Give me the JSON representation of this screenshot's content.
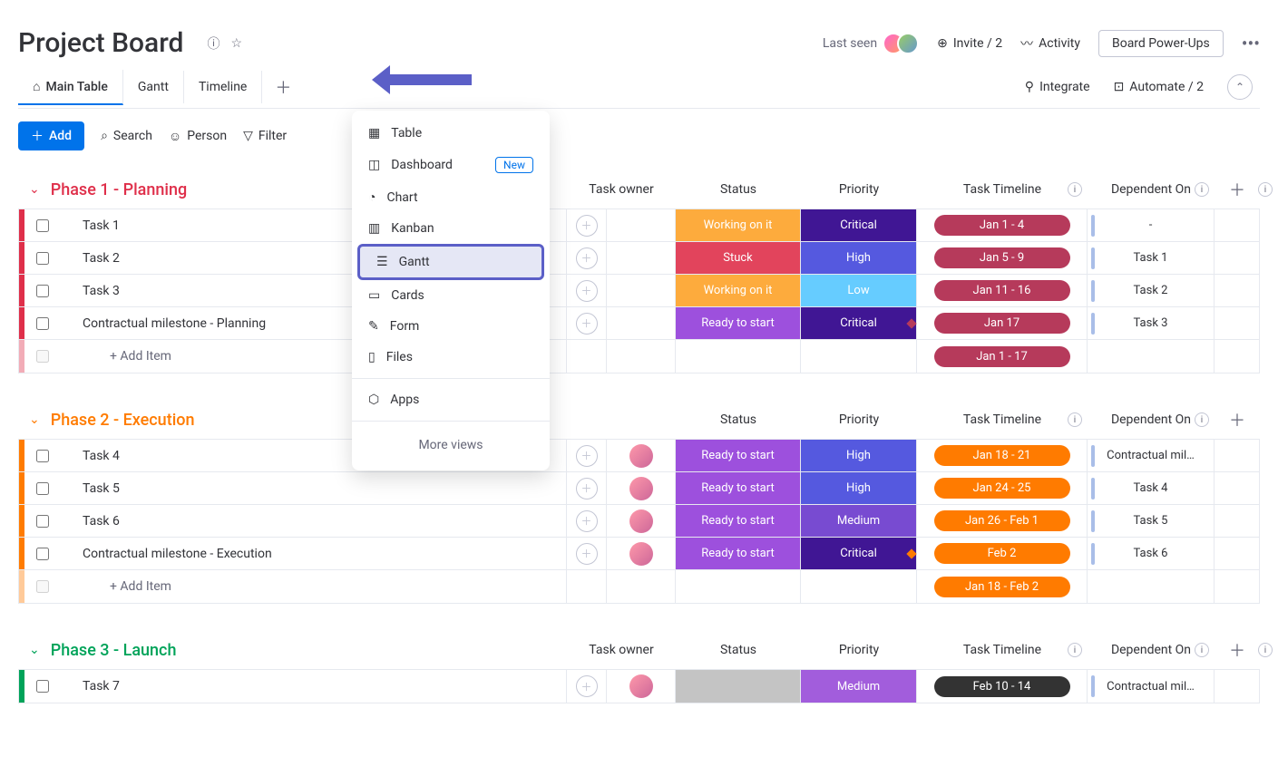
{
  "header": {
    "title": "Project Board",
    "last_seen": "Last seen",
    "invite": "Invite / 2",
    "activity": "Activity",
    "powerups": "Board Power-Ups"
  },
  "tabs": {
    "items": [
      {
        "label": "Main Table",
        "active": true
      },
      {
        "label": "Gantt"
      },
      {
        "label": "Timeline"
      }
    ],
    "integrate": "Integrate",
    "automate": "Automate / 2"
  },
  "toolbar": {
    "add": "Add",
    "search": "Search",
    "person": "Person",
    "filter": "Filter"
  },
  "popup": {
    "items": [
      "Table",
      "Dashboard",
      "Chart",
      "Kanban",
      "Gantt",
      "Cards",
      "Form",
      "Files"
    ],
    "new_badge": "New",
    "apps": "Apps",
    "more": "More views"
  },
  "columns": {
    "owner": "Task owner",
    "status": "Status",
    "priority": "Priority",
    "timeline": "Task Timeline",
    "dep": "Dependent On"
  },
  "groups": [
    {
      "name": "Phase 1 - Planning",
      "color": "#df2f4a",
      "rows": [
        {
          "name": "Task 1",
          "status": "Working on it",
          "status_color": "#fdab3d",
          "priority": "Critical",
          "priority_color": "#401694",
          "timeline": "Jan 1 - 4",
          "timeline_color": "#b63a5b",
          "dep": "-",
          "dep_color": "#a9bee8"
        },
        {
          "name": "Task 2",
          "status": "Stuck",
          "status_color": "#e2445c",
          "priority": "High",
          "priority_color": "#5559df",
          "timeline": "Jan 5 - 9",
          "timeline_color": "#b63a5b",
          "dep": "Task 1",
          "dep_color": "#a9bee8"
        },
        {
          "name": "Task 3",
          "status": "Working on it",
          "status_color": "#fdab3d",
          "priority": "Low",
          "priority_color": "#66ccff",
          "timeline": "Jan 11 - 16",
          "timeline_color": "#b63a5b",
          "dep": "Task 2",
          "dep_color": "#a9bee8"
        },
        {
          "name": "Contractual milestone - Planning",
          "status": "Ready to start",
          "status_color": "#9d50dd",
          "priority": "Critical",
          "priority_color": "#401694",
          "timeline": "Jan 17",
          "timeline_color": "#b63a5b",
          "dep": "Task 3",
          "dep_color": "#a9bee8",
          "milestone": true
        }
      ],
      "summary_timeline": "Jan 1 - 17",
      "summary_color": "#b63a5b",
      "add_item": "+ Add Item"
    },
    {
      "name": "Phase 2 - Execution",
      "color": "#ff7b00",
      "rows": [
        {
          "name": "Task 4",
          "status": "Ready to start",
          "status_color": "#9d50dd",
          "priority": "High",
          "priority_color": "#5559df",
          "timeline": "Jan 18 - 21",
          "timeline_color": "#ff7b00",
          "dep": "Contractual mil…",
          "dep_color": "#a9bee8",
          "has_owner": true
        },
        {
          "name": "Task 5",
          "status": "Ready to start",
          "status_color": "#9d50dd",
          "priority": "High",
          "priority_color": "#5559df",
          "timeline": "Jan 24 - 25",
          "timeline_color": "#ff7b00",
          "dep": "Task 4",
          "dep_color": "#a9bee8",
          "has_owner": true
        },
        {
          "name": "Task 6",
          "status": "Ready to start",
          "status_color": "#9d50dd",
          "priority": "Medium",
          "priority_color": "#784bd1",
          "timeline": "Jan 26 - Feb 1",
          "timeline_color": "#ff7b00",
          "dep": "Task 5",
          "dep_color": "#a9bee8",
          "has_owner": true
        },
        {
          "name": "Contractual milestone - Execution",
          "status": "Ready to start",
          "status_color": "#9d50dd",
          "priority": "Critical",
          "priority_color": "#401694",
          "timeline": "Feb 2",
          "timeline_color": "#ff7b00",
          "dep": "Task 6",
          "dep_color": "#a9bee8",
          "has_owner": true,
          "milestone": true
        }
      ],
      "summary_timeline": "Jan 18 - Feb 2",
      "summary_color": "#ff7b00",
      "add_item": "+ Add Item"
    },
    {
      "name": "Phase 3 - Launch",
      "color": "#00a359",
      "rows": [
        {
          "name": "Task 7",
          "status": "",
          "status_color": "#c4c4c4",
          "priority": "Medium",
          "priority_color": "#a25ddc",
          "timeline": "Feb 10 - 14",
          "timeline_color": "#333333",
          "dep": "Contractual mil…",
          "dep_color": "#a9bee8",
          "has_owner": true
        }
      ],
      "show_column_headers": true
    }
  ]
}
